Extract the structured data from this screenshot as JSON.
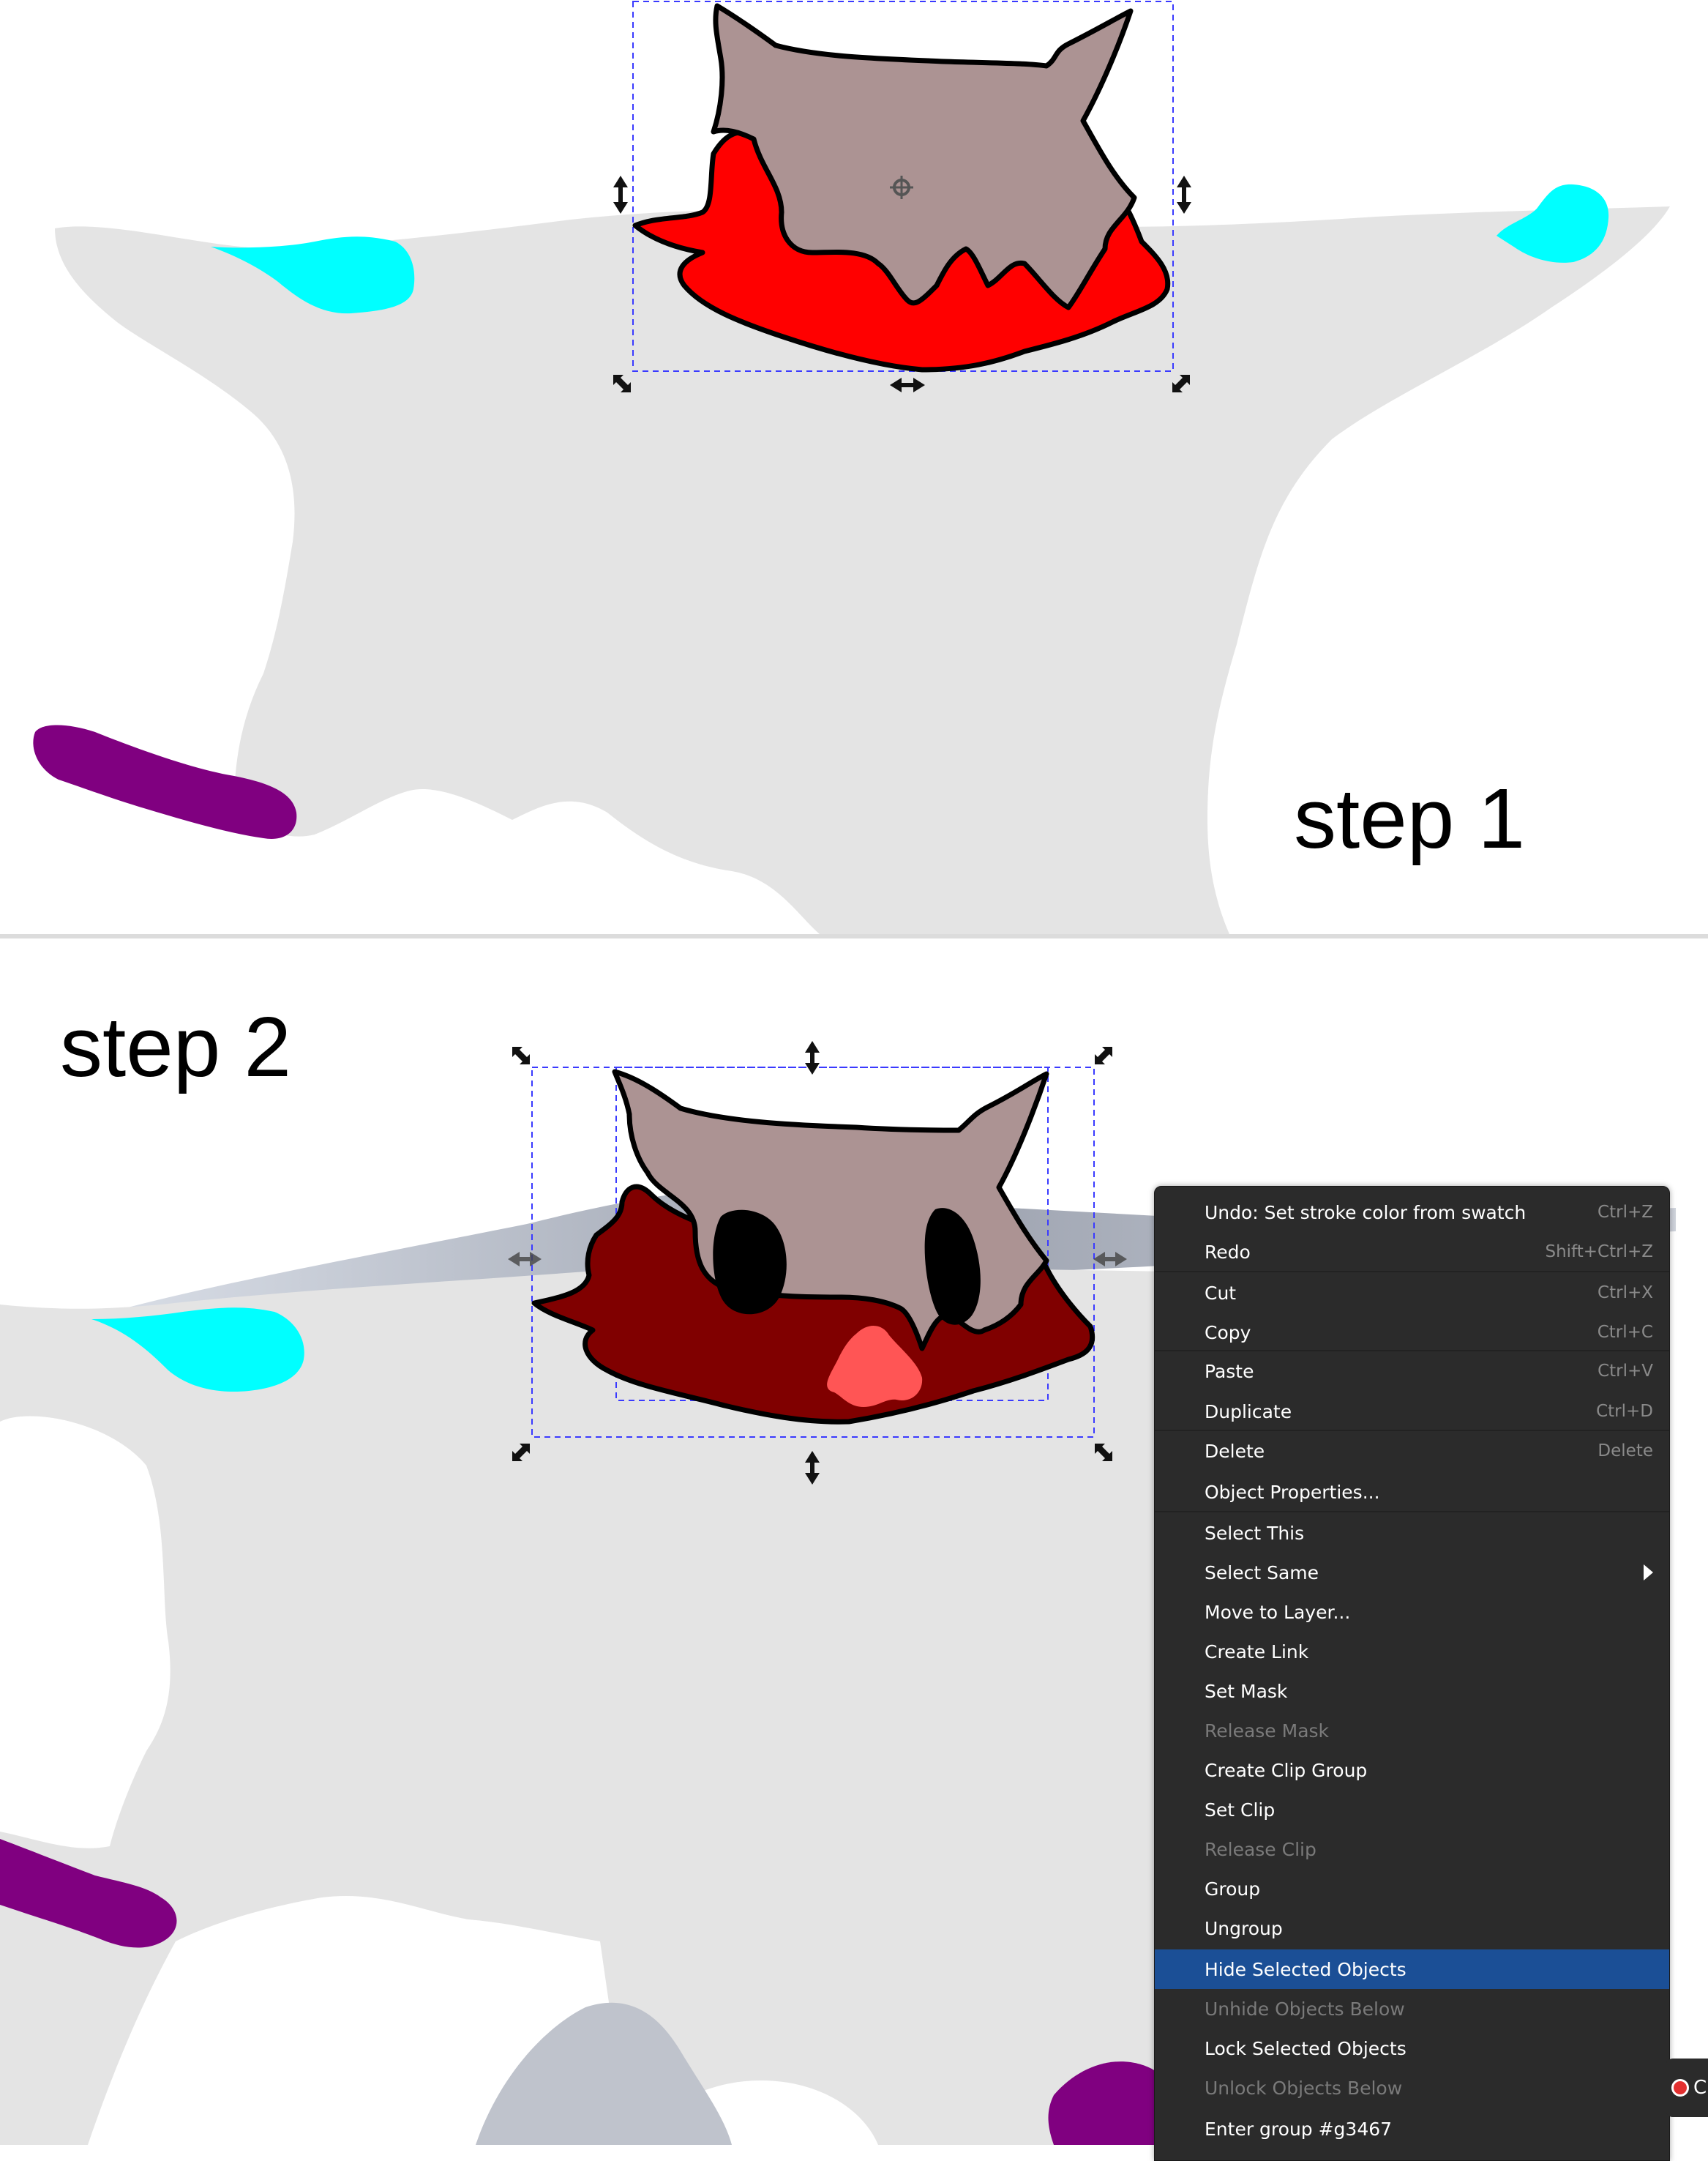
{
  "step1": {
    "label": "step 1"
  },
  "step2": {
    "label": "step 2"
  },
  "colors": {
    "canvas_background": "#ffffff",
    "skin_gray": "#e4e4e4",
    "accent_cyan": "#00ffff",
    "accent_purple": "#800080",
    "head_fill": "#ac9393",
    "collar_red": "#ff0000",
    "collar_dark_red": "#800000",
    "nose_pink": "#ff5555",
    "menu_background": "#2b2b2b",
    "menu_highlight": "#1b4f96"
  },
  "context_menu": {
    "items": [
      {
        "label": "Undo: Set stroke color from swatch",
        "shortcut": "Ctrl+Z"
      },
      {
        "label": "Redo",
        "shortcut": "Shift+Ctrl+Z"
      },
      {
        "label": "Cut",
        "shortcut": "Ctrl+X"
      },
      {
        "label": "Copy",
        "shortcut": "Ctrl+C"
      },
      {
        "label": "Paste",
        "shortcut": "Ctrl+V"
      },
      {
        "label": "Duplicate",
        "shortcut": "Ctrl+D"
      },
      {
        "label": "Delete",
        "shortcut": "Delete"
      },
      {
        "label": "Object Properties...",
        "shortcut": ""
      },
      {
        "label": "Select This",
        "shortcut": ""
      },
      {
        "label": "Select Same",
        "shortcut": ""
      },
      {
        "label": "Move to Layer...",
        "shortcut": ""
      },
      {
        "label": "Create Link",
        "shortcut": ""
      },
      {
        "label": "Set Mask",
        "shortcut": ""
      },
      {
        "label": "Release Mask",
        "shortcut": ""
      },
      {
        "label": "Create Clip Group",
        "shortcut": ""
      },
      {
        "label": "Set Clip",
        "shortcut": ""
      },
      {
        "label": "Release Clip",
        "shortcut": ""
      },
      {
        "label": "Group",
        "shortcut": ""
      },
      {
        "label": "Ungroup",
        "shortcut": ""
      },
      {
        "label": "Hide Selected Objects",
        "shortcut": ""
      },
      {
        "label": "Unhide Objects Below",
        "shortcut": ""
      },
      {
        "label": "Lock Selected Objects",
        "shortcut": ""
      },
      {
        "label": "Unlock Objects Below",
        "shortcut": ""
      },
      {
        "label": "Enter group #g3467",
        "shortcut": ""
      }
    ],
    "disabled_items": [
      "Release Mask",
      "Release Clip",
      "Unhide Objects Below",
      "Unlock Objects Below"
    ],
    "highlighted_item": "Hide Selected Objects",
    "submenu_items": [
      "Select Same"
    ]
  },
  "floating_chip": {
    "icon": "record-icon",
    "text": "C"
  }
}
